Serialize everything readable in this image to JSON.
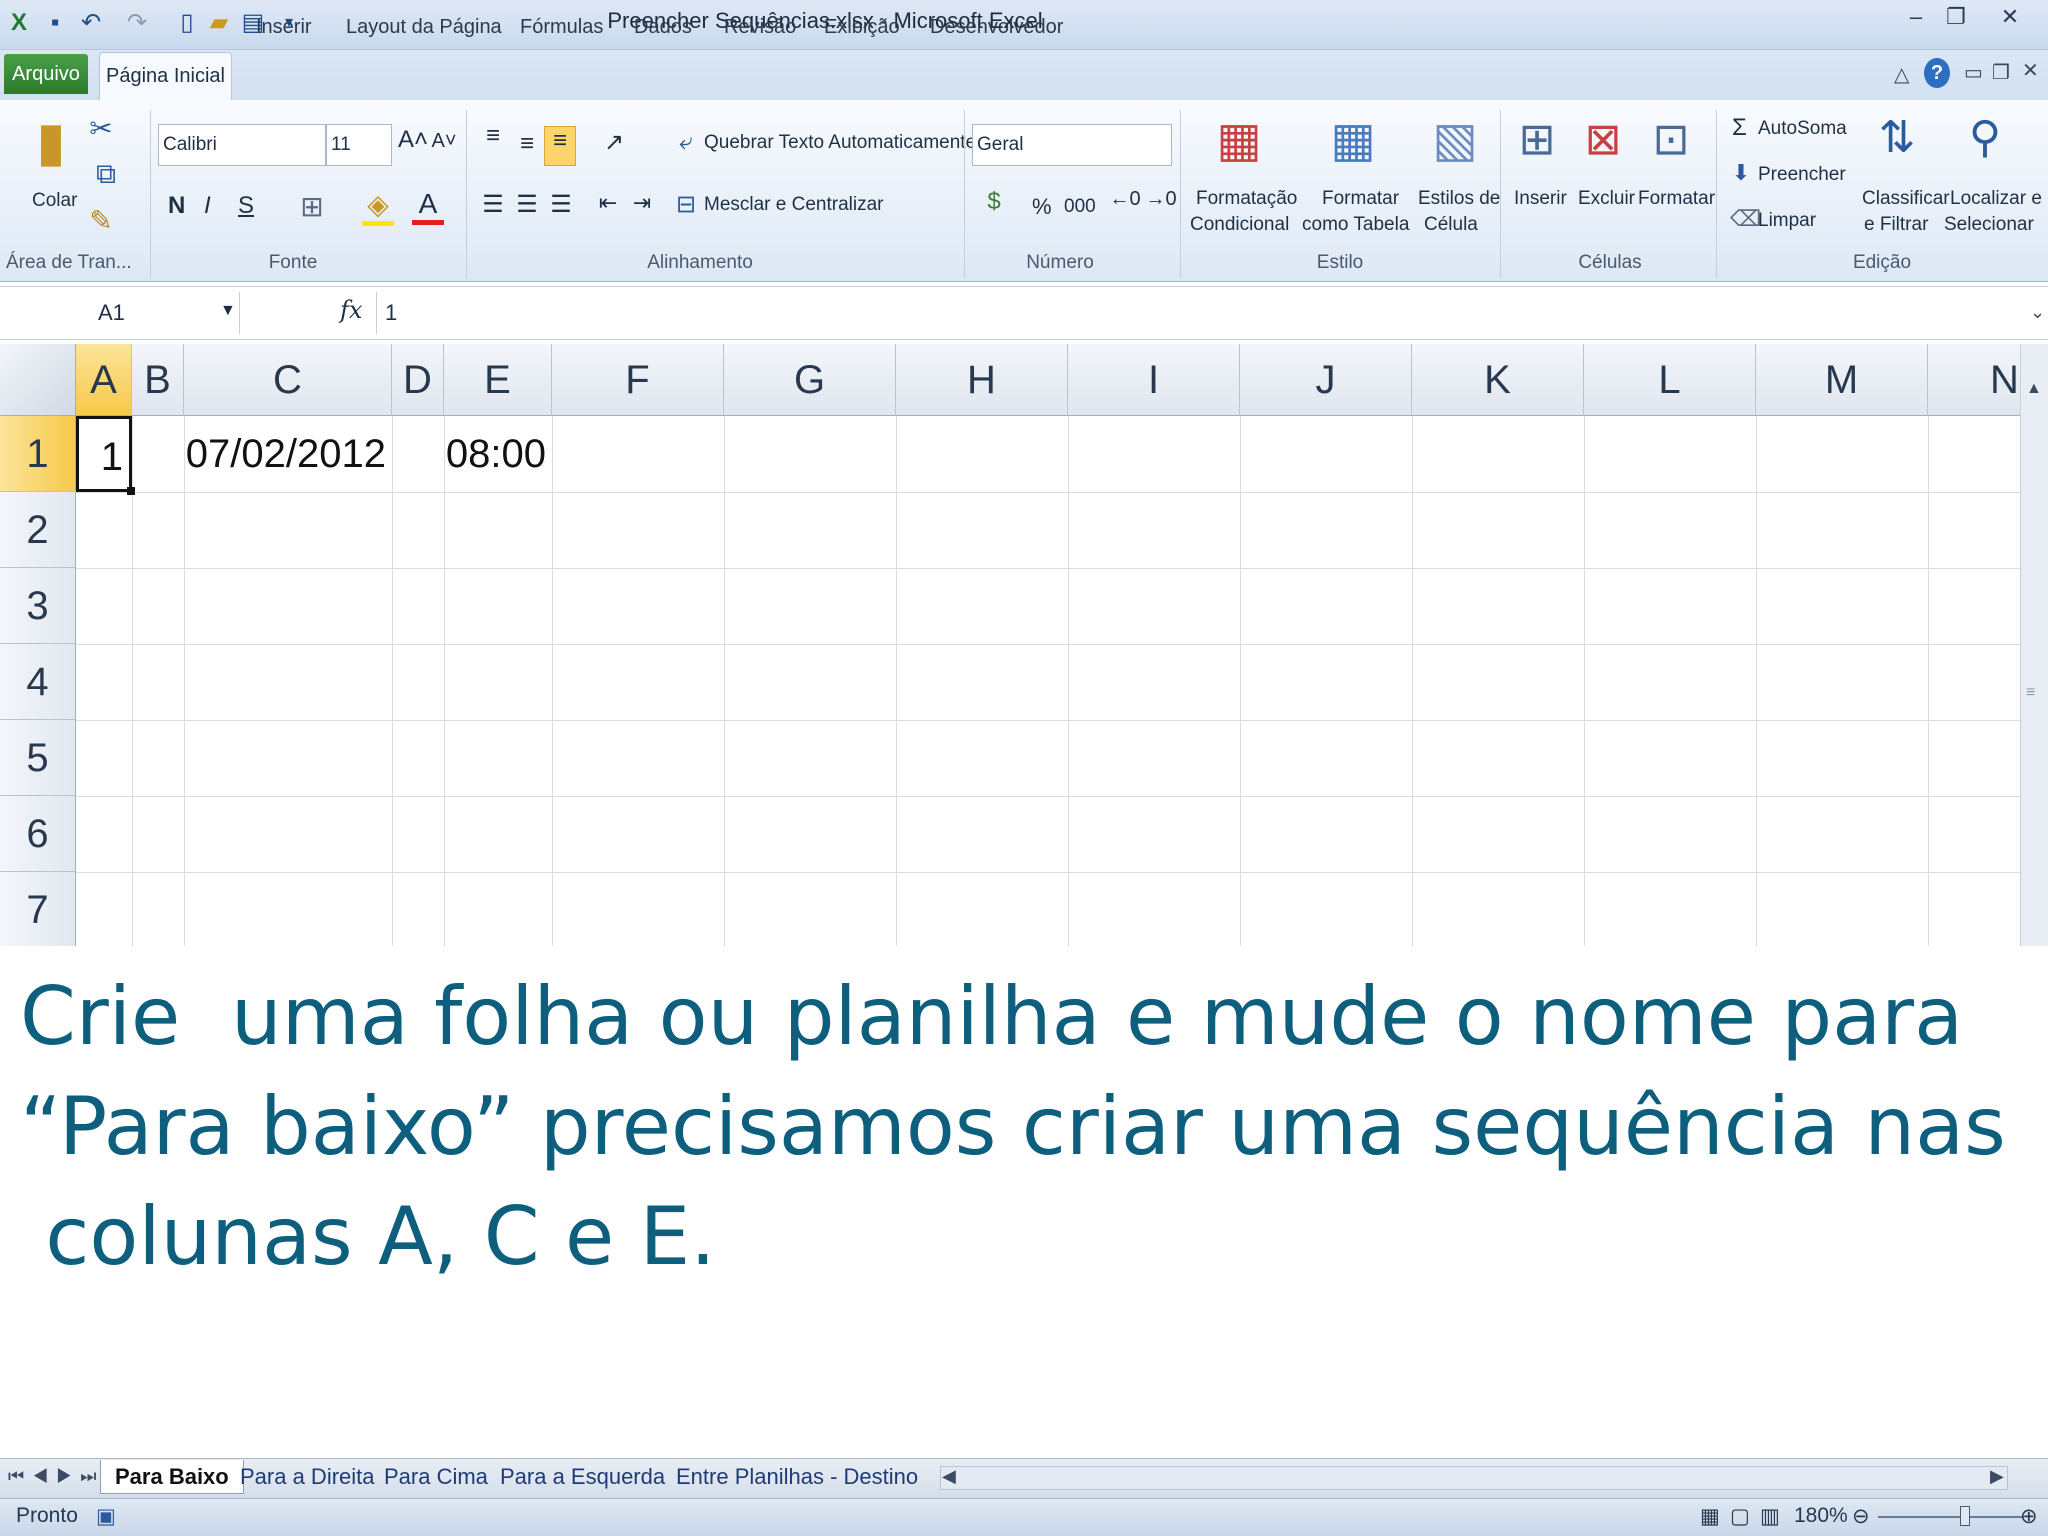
{
  "window": {
    "title": "Preencher Sequências.xlsx - Microsoft Excel"
  },
  "ribbon_tabs": [
    "Arquivo",
    "Página Inicial",
    "Inserir",
    "Layout da Página",
    "Fórmulas",
    "Dados",
    "Revisão",
    "Exibição",
    "Desenvolvedor"
  ],
  "clipboard": {
    "paste_label": "Colar",
    "group_label": "Área de Tran..."
  },
  "font": {
    "name": "Calibri",
    "size": "11",
    "group_label": "Fonte",
    "bold": "N",
    "italic": "I",
    "underline": "S"
  },
  "alignment": {
    "wrap_label": "Quebrar Texto Automaticamente",
    "merge_label": "Mesclar e Centralizar",
    "group_label": "Alinhamento"
  },
  "number": {
    "format": "Geral",
    "group_label": "Número",
    "percent": "%",
    "thousands": "000"
  },
  "styles": {
    "conditional_1": "Formatação",
    "conditional_2": "Condicional",
    "table_1": "Formatar",
    "table_2": "como Tabela",
    "cell_1": "Estilos de",
    "cell_2": "Célula",
    "group_label": "Estilo"
  },
  "cells_group": {
    "insert": "Inserir",
    "delete": "Excluir",
    "format": "Formatar",
    "group_label": "Células"
  },
  "editing": {
    "autosum": "AutoSoma",
    "fill": "Preencher",
    "clear": "Limpar",
    "sort_1": "Classificar",
    "sort_2": "e Filtrar",
    "find_1": "Localizar e",
    "find_2": "Selecionar",
    "group_label": "Edição"
  },
  "formula_bar": {
    "name_box": "A1",
    "fx": "fx",
    "value": "1"
  },
  "columns": [
    "A",
    "B",
    "C",
    "D",
    "E",
    "F",
    "G",
    "H",
    "I",
    "J",
    "K",
    "L",
    "M",
    "N"
  ],
  "rows": [
    "1",
    "2",
    "3",
    "4",
    "5",
    "6",
    "7"
  ],
  "cells": {
    "A1": "1",
    "C1": "07/02/2012",
    "E1": "08:00"
  },
  "caption": {
    "line1": "Crie  uma folha ou planilha e mude o nome para",
    "line2": "“Para baixo” precisamos criar uma sequência nas",
    "line3": " colunas A, C e E."
  },
  "sheet_tabs": [
    "Para Baixo",
    "Para a Direita",
    "Para Cima",
    "Para a Esquerda",
    "Entre Planilhas - Destino"
  ],
  "status": {
    "ready": "Pronto",
    "zoom": "180%"
  }
}
